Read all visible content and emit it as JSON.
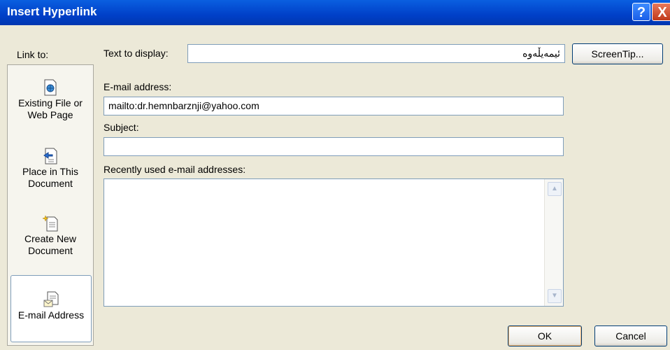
{
  "window": {
    "title": "Insert Hyperlink",
    "help_glyph": "?",
    "close_glyph": "X"
  },
  "link_to": {
    "label": "Link to:",
    "items": [
      {
        "line1": "Existing File or",
        "line2": "Web Page",
        "icon": "web-page-icon",
        "selected": false
      },
      {
        "line1": "Place in This",
        "line2": "Document",
        "icon": "place-in-document-icon",
        "selected": false
      },
      {
        "line1": "Create New",
        "line2": "Document",
        "icon": "new-document-icon",
        "selected": false
      },
      {
        "line1": "E-mail Address",
        "line2": "",
        "icon": "email-address-icon",
        "selected": true
      }
    ]
  },
  "text_to_display": {
    "label": "Text to display:",
    "value": "ئیمەیڵەوە"
  },
  "screentip_button": "ScreenTip...",
  "email_address": {
    "label": "E-mail address:",
    "value": "mailto:dr.hemnbarznji@yahoo.com"
  },
  "subject": {
    "label": "Subject:",
    "value": ""
  },
  "recent": {
    "label": "Recently used e-mail addresses:",
    "items": []
  },
  "buttons": {
    "ok": "OK",
    "cancel": "Cancel"
  },
  "colors": {
    "titlebar": "#0040c8",
    "dialog_bg": "#ece9d8",
    "field_border": "#7f9db9"
  }
}
